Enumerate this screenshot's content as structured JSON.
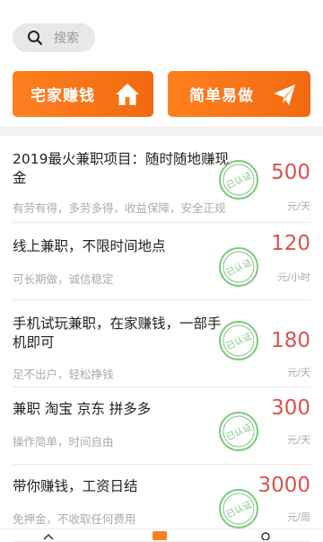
{
  "search": {
    "placeholder": "搜索"
  },
  "banners": [
    {
      "label": "宅家赚钱",
      "icon": "home-icon"
    },
    {
      "label": "简单易做",
      "icon": "paper-plane-icon"
    }
  ],
  "badge_text": "已认证",
  "colors": {
    "accent": "#f5821f",
    "price": "#d9534f",
    "stamp": "#7dc77d"
  },
  "jobs": [
    {
      "title": "2019最火兼职项目：随时随地赚现金",
      "desc": "有劳有得，多劳多得，收益保障，安全正规",
      "price": "500",
      "unit": "元/天"
    },
    {
      "title": "线上兼职，不限时间地点",
      "desc": "可长期做，诚信稳定",
      "price": "120",
      "unit": "元/小时"
    },
    {
      "title": "手机试玩兼职，在家赚钱，一部手机即可",
      "desc": "足不出户，轻松挣钱",
      "price": "180",
      "unit": "元/天"
    },
    {
      "title": "兼职 淘宝 京东 拼多多",
      "desc": "操作简单，时间自由",
      "price": "300",
      "unit": "元/天"
    },
    {
      "title": "带你赚钱，工资日结",
      "desc": "免押金，不收取任何费用",
      "price": "3000",
      "unit": "元/周"
    }
  ]
}
